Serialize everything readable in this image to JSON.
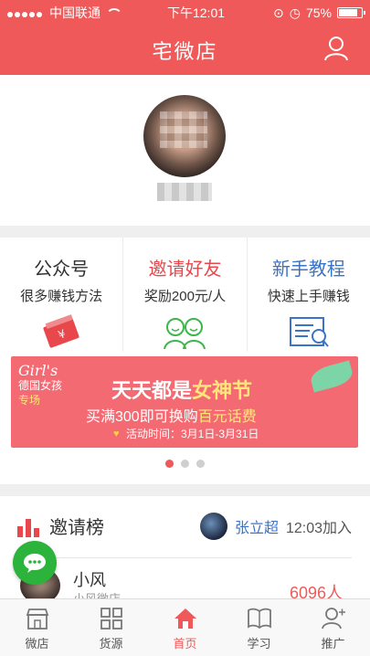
{
  "status_bar": {
    "carrier": "中国联通",
    "time": "下午12:01",
    "battery": "75%"
  },
  "header": {
    "title": "宅微店"
  },
  "features": [
    {
      "title": "公众号",
      "subtitle": "很多赚钱方法",
      "title_color": "#333333"
    },
    {
      "title": "邀请好友",
      "subtitle": "奖励200元/人",
      "title_color": "#e8474c"
    },
    {
      "title": "新手教程",
      "subtitle": "快速上手赚钱",
      "title_color": "#3a74c9"
    }
  ],
  "banner": {
    "brand": "Girl's",
    "brand_cn": "德国女孩",
    "brand_tag": "专场",
    "headline_a": "天天都是",
    "headline_b": "女神节",
    "sub_a": "买满300即可换购",
    "sub_b": "百元话费",
    "time": "活动时间：3月1日-3月31日",
    "pages": 3,
    "active_page": 1
  },
  "ranking": {
    "title": "邀请榜",
    "recent_name": "张立超",
    "recent_text": "12:03加入",
    "entries": [
      {
        "name": "小风",
        "shop": "小风微店",
        "count": "6096人"
      }
    ]
  },
  "tabs": [
    {
      "label": "微店",
      "icon": "shop-icon"
    },
    {
      "label": "货源",
      "icon": "grid-icon"
    },
    {
      "label": "首页",
      "icon": "home-icon"
    },
    {
      "label": "学习",
      "icon": "book-icon"
    },
    {
      "label": "推广",
      "icon": "promote-icon"
    }
  ],
  "colors": {
    "brand_red": "#ef5959",
    "link_blue": "#3a74c9",
    "wechat_green": "#2bb33b"
  }
}
